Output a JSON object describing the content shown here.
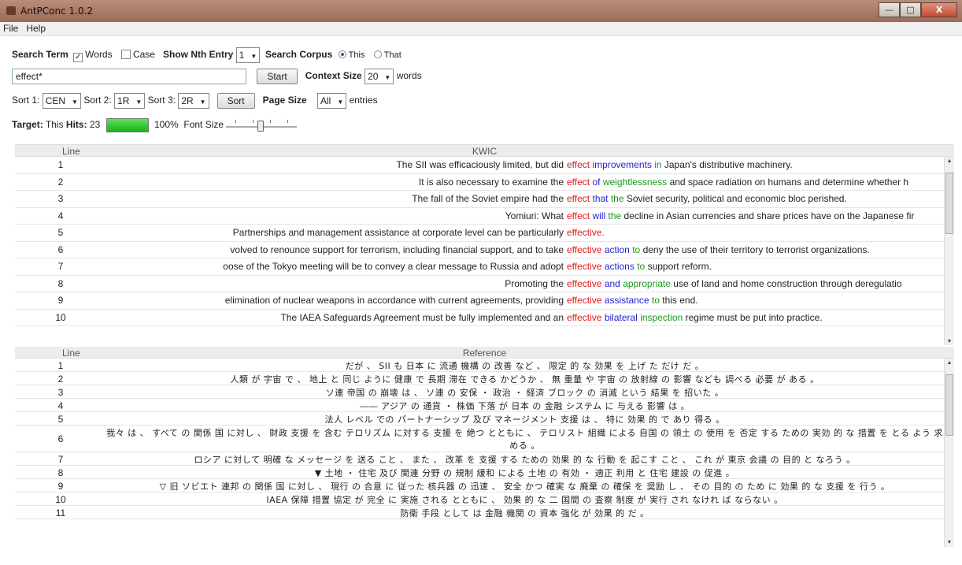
{
  "window": {
    "title": "AntPConc 1.0.2",
    "min": "—",
    "max": "□",
    "close": "X"
  },
  "menu": [
    "File",
    "Help"
  ],
  "controls": {
    "search_term": "Search Term",
    "words": "Words",
    "case": "Case",
    "show_nth": "Show Nth Entry",
    "nth_value": "1",
    "search_corpus": "Search Corpus",
    "this": "This",
    "that": "That",
    "query": "effect*",
    "start": "Start",
    "context_size": "Context Size",
    "context_value": "20",
    "words_unit": "words",
    "sort1_label": "Sort 1:",
    "sort1": "CEN",
    "sort2_label": "Sort 2:",
    "sort2": "1R",
    "sort3_label": "Sort 3:",
    "sort3": "2R",
    "sort_btn": "Sort",
    "page_size": "Page Size",
    "page_value": "All",
    "entries": "entries",
    "target_label": "Target:",
    "target": "This",
    "hits_label": "Hits:",
    "hits": "23",
    "progress_text": "100%",
    "progress": 1.0,
    "font_size": "Font Size"
  },
  "kwic": {
    "col_line": "Line",
    "col_kwic": "KWIC",
    "rows": [
      {
        "n": "1",
        "left": "The SII was efficaciously limited, but did",
        "key": "effect",
        "r1": "improvements",
        "r2": "in",
        "rest": "Japan's distributive machinery."
      },
      {
        "n": "2",
        "left": "It is also necessary to examine the",
        "key": "effect",
        "r1": "of",
        "r2": "weightlessness",
        "rest": "and space radiation on humans and determine whether h"
      },
      {
        "n": "3",
        "left": "The fall of the Soviet empire had the",
        "key": "effect",
        "r1": "that",
        "r2": "the",
        "rest": "Soviet security, political and economic bloc perished."
      },
      {
        "n": "4",
        "left": "Yomiuri: What",
        "key": "effect",
        "r1": "will",
        "r2": "the",
        "rest": "decline in Asian currencies and share prices have on the Japanese fir"
      },
      {
        "n": "5",
        "left": "Partnerships and management assistance at corporate level can be particularly",
        "key": "effective.",
        "r1": "",
        "r2": "",
        "rest": ""
      },
      {
        "n": "6",
        "left": "volved to renounce support for terrorism, including financial support, and to take",
        "key": "effective",
        "r1": "action",
        "r2": "to",
        "rest": "deny the use of their territory to terrorist organizations."
      },
      {
        "n": "7",
        "left": "oose of the Tokyo meeting will be to convey a clear message to Russia and adopt",
        "key": "effective",
        "r1": "actions",
        "r2": "to",
        "rest": "support reform."
      },
      {
        "n": "8",
        "left": "Promoting the",
        "key": "effective",
        "r1": "and",
        "r2": "appropriate",
        "rest": "use of land and home construction through deregulatio"
      },
      {
        "n": "9",
        "left": "elimination of nuclear weapons in accordance with current agreements, providing",
        "key": "effective",
        "r1": "assistance",
        "r2": "to",
        "rest": "this end."
      },
      {
        "n": "10",
        "left": "The IAEA Safeguards Agreement must be fully implemented and an",
        "key": "effective",
        "r1": "bilateral",
        "r2": "inspection",
        "rest": "regime must be put into practice."
      }
    ]
  },
  "reference": {
    "col_line": "Line",
    "col_ref": "Reference",
    "rows": [
      {
        "n": "1",
        "text": "だが 、 SII も 日本 に 流通 機構 の 改善 など 、 限定 的 な 効果 を 上げ た だけ だ 。"
      },
      {
        "n": "2",
        "text": "人類 が 宇宙 で 、 地上 と 同じ ように 健康 で 長期 滞在 できる かどうか 、 無 重量 や 宇宙 の 放射線 の 影響 なども 調べる 必要 が ある 。"
      },
      {
        "n": "3",
        "text": "ソ連 帝国 の 崩壊 は 、 ソ連 の 安保 ・ 政治 ・ 経済 ブロック の 消滅 という 結果 を 招いた 。"
      },
      {
        "n": "4",
        "text": "―― アジア の 通貨 ・ 株価 下落 が 日本 の 金融 システム に 与える 影響 は 。"
      },
      {
        "n": "5",
        "text": "法人 レベル での パートナーシップ 及び マネージメント 支援 は 、 特に 効果 的 で あり 得る 。"
      },
      {
        "n": "6",
        "text": "我々 は 、 すべて の 関係 国 に対し 、 財政 支援 を 含む テロリズム に対する 支援 を 絶つ とともに 、 テロリスト 組織 による 自国 の 領土 の 使用 を 否定 する ための 実効 的 な 措置 を とる よう 求",
        "text2": "める 。"
      },
      {
        "n": "7",
        "text": "ロシア に対して 明確 な メッセージ を 送る こと 、 また 、 改革 を 支援 する ための 効果 的 な 行動 を 起こす こと 、 これ が 東京 会議 の 目的 と なろう 。"
      },
      {
        "n": "8",
        "text": "▼ 土地 ・ 住宅 及び 関連 分野 の 規制 緩和 による 土地 の 有効 ・ 適正 利用 と 住宅 建設 の 促進 。"
      },
      {
        "n": "9",
        "text": "▽ 旧 ソビエト 連邦 の 関係 国 に対し 、 現行 の 合意 に 従った 核兵器 の 迅速 、 安全 かつ 確実 な 廃棄 の 確保 を 奨励 し 、 その 目的 の ため に 効果 的 な 支援 を 行う 。"
      },
      {
        "n": "10",
        "text": "IAEA 保障 措置 協定 が 完全 に 実施 される とともに 、 効果 的 な 二 国間 の 査察 制度 が 実行 され なけれ ば ならない 。"
      },
      {
        "n": "11",
        "text": "防衛 手段 として は 金融 機関 の 資本 強化 が 効果 的 だ 。"
      }
    ]
  },
  "colors": {
    "node": "#e01818",
    "r1": "#2222cc",
    "r2": "#1a9a1a"
  }
}
